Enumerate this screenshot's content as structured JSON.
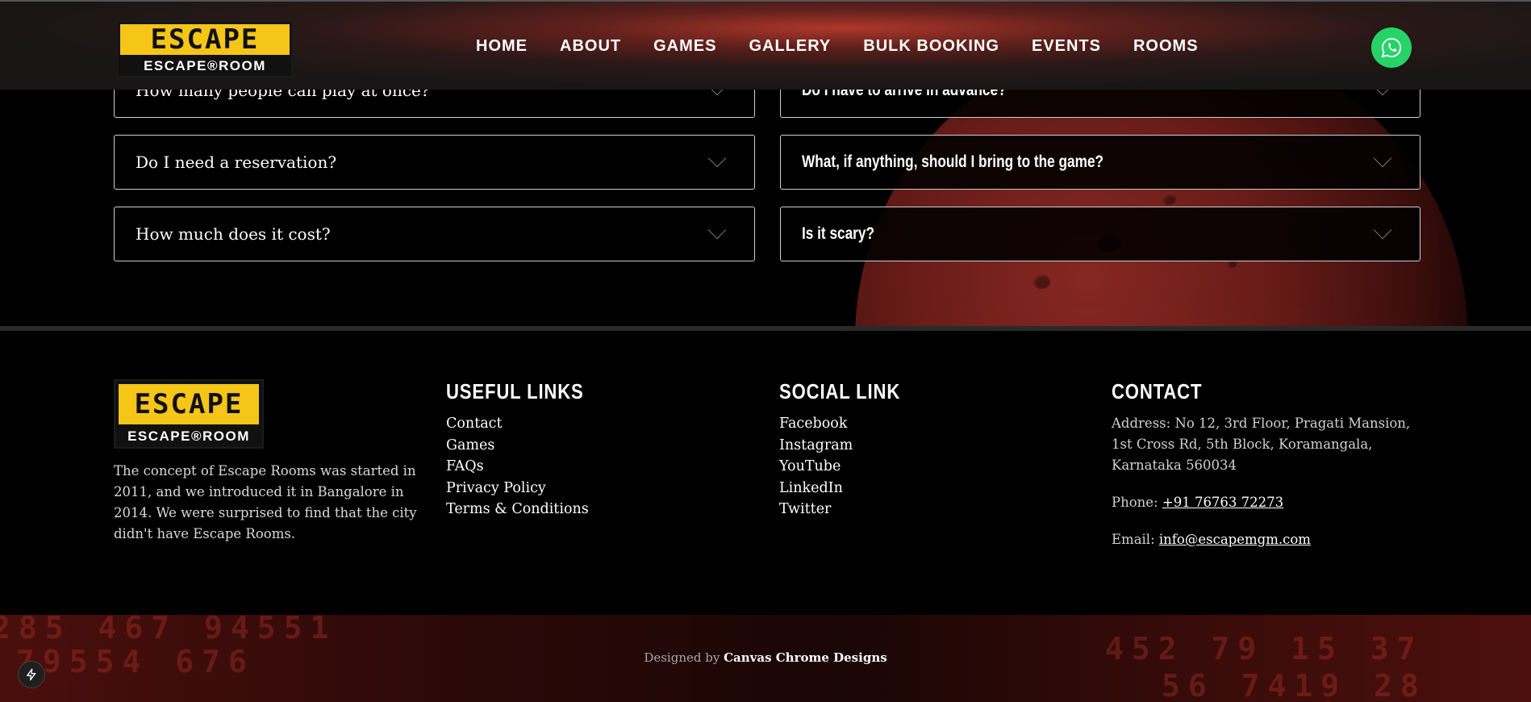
{
  "header": {
    "logo": {
      "top_text": "ESCAPE",
      "bottom_text": "ESCAPE®ROOM"
    },
    "nav": [
      "HOME",
      "ABOUT",
      "GAMES",
      "GALLERY",
      "BULK BOOKING",
      "EVENTS",
      "ROOMS"
    ],
    "whatsapp_icon": "whatsapp-icon"
  },
  "faq": {
    "left": [
      "How many people can play at once?",
      "Do I need a reservation?",
      "How much does it cost?"
    ],
    "right": [
      "Do I have to arrive in advance?",
      "What, if anything, should I bring to the game?",
      "Is it scary?"
    ]
  },
  "footer": {
    "logo": {
      "top_text": "ESCAPE",
      "bottom_text": "ESCAPE®ROOM"
    },
    "about": "The concept of Escape Rooms was started in 2011, and we introduced it in Bangalore in 2014. We were surprised to find that the city didn't have Escape Rooms.",
    "useful_links": {
      "title": "USEFUL LINKS",
      "items": [
        "Contact",
        "Games",
        "FAQs",
        "Privacy Policy",
        "Terms & Conditions"
      ]
    },
    "social": {
      "title": "SOCIAL LINK",
      "items": [
        "Facebook",
        "Instagram",
        "YouTube",
        "LinkedIn",
        "Twitter"
      ]
    },
    "contact": {
      "title": "CONTACT",
      "address_label": "Address:",
      "address": "No 12, 3rd Floor, Pragati Mansion, 1st Cross Rd, 5th Block, Koramangala, Karnataka 560034",
      "phone_label": "Phone:",
      "phone": "+91 76763 72273",
      "email_label": "Email:",
      "email": "info@escapemgm.com"
    }
  },
  "credit": {
    "prefix": "Designed by",
    "designer": "Canvas Chrome Designs"
  },
  "colors": {
    "brand_yellow": "#f5c518",
    "whatsapp_green": "#25d366",
    "accent_red": "#8e2a24"
  }
}
